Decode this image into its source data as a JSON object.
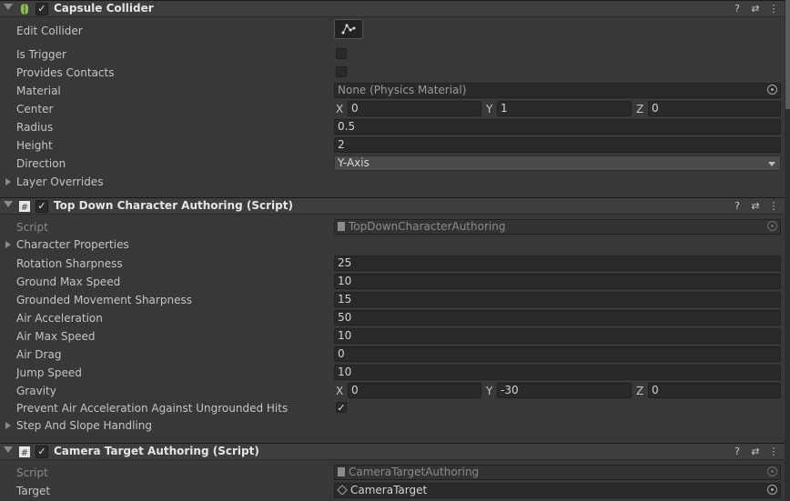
{
  "colors": {
    "panel_bg": "#383838",
    "header_bg": "#3e3e3e",
    "field_bg": "#2a2a2a",
    "dropdown_bg": "#4b4b4b"
  },
  "capsule": {
    "title": "Capsule Collider",
    "icon": "capsule-collider-icon",
    "edit_collider_label": "Edit Collider",
    "is_trigger_label": "Is Trigger",
    "is_trigger": false,
    "provides_contacts_label": "Provides Contacts",
    "provides_contacts": false,
    "material_label": "Material",
    "material_value": "None (Physics Material)",
    "center_label": "Center",
    "center": {
      "x_label": "X",
      "x": "0",
      "y_label": "Y",
      "y": "1",
      "z_label": "Z",
      "z": "0"
    },
    "radius_label": "Radius",
    "radius": "0.5",
    "height_label": "Height",
    "height": "2",
    "direction_label": "Direction",
    "direction": "Y-Axis",
    "layer_overrides_label": "Layer Overrides"
  },
  "topdown": {
    "title": "Top Down Character Authoring (Script)",
    "script_label": "Script",
    "script_value": "TopDownCharacterAuthoring",
    "character_properties_label": "Character Properties",
    "fields": [
      {
        "label": "Rotation Sharpness",
        "value": "25"
      },
      {
        "label": "Ground Max Speed",
        "value": "10"
      },
      {
        "label": "Grounded Movement Sharpness",
        "value": "15"
      },
      {
        "label": "Air Acceleration",
        "value": "50"
      },
      {
        "label": "Air Max Speed",
        "value": "10"
      },
      {
        "label": "Air Drag",
        "value": "0"
      },
      {
        "label": "Jump Speed",
        "value": "10"
      }
    ],
    "gravity_label": "Gravity",
    "gravity": {
      "x_label": "X",
      "x": "0",
      "y_label": "Y",
      "y": "-30",
      "z_label": "Z",
      "z": "0"
    },
    "prevent_label": "Prevent Air Acceleration Against Ungrounded Hits",
    "prevent": true,
    "step_label": "Step And Slope Handling"
  },
  "camera": {
    "title": "Camera Target Authoring (Script)",
    "script_label": "Script",
    "script_value": "CameraTargetAuthoring",
    "target_label": "Target",
    "target_value": "CameraTarget"
  },
  "header_icons": {
    "help": "?",
    "presets": "⇄",
    "menu": "⋮"
  }
}
